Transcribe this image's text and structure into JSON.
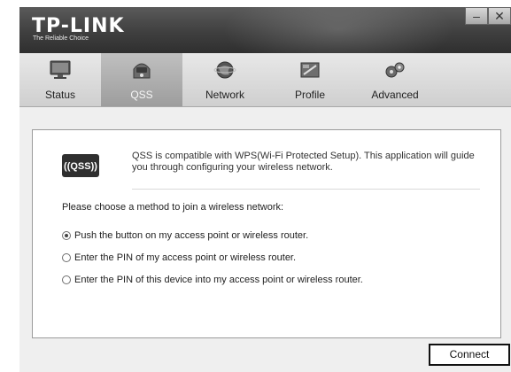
{
  "window": {
    "brand": "TP-LINK",
    "tagline": "The Reliable Choice",
    "controls": {
      "minimize_glyph": "–",
      "close_glyph": "✕"
    }
  },
  "tabs": [
    {
      "label": "Status",
      "icon": "monitor-icon",
      "active": false
    },
    {
      "label": "QSS",
      "icon": "qss-icon",
      "active": true
    },
    {
      "label": "Network",
      "icon": "globe-icon",
      "active": false
    },
    {
      "label": "Profile",
      "icon": "profile-icon",
      "active": false
    },
    {
      "label": "Advanced",
      "icon": "gears-icon",
      "active": false
    }
  ],
  "qss_panel": {
    "logo_text": "((QSS))",
    "intro": "QSS is compatible with WPS(Wi-Fi Protected Setup). This application will guide you through configuring your wireless network.",
    "prompt": "Please choose a method to join a wireless network:",
    "options": [
      {
        "label": "Push the button on my access point or wireless router.",
        "selected": true
      },
      {
        "label": "Enter the PIN of my access point or wireless router.",
        "selected": false
      },
      {
        "label": "Enter the PIN of this device into my access point or wireless router.",
        "selected": false
      }
    ]
  },
  "actions": {
    "connect_label": "Connect"
  }
}
